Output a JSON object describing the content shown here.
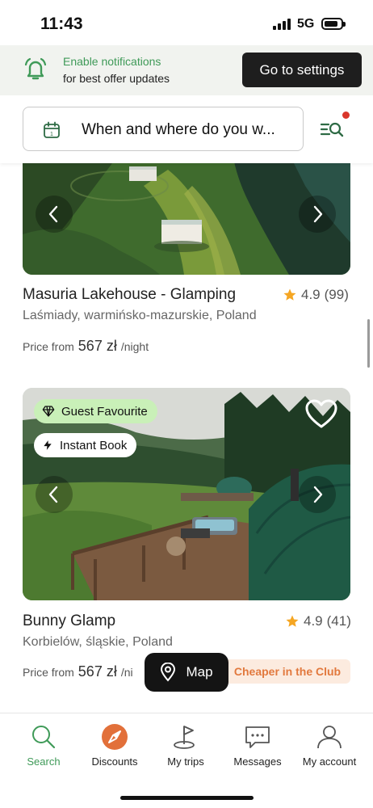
{
  "status_bar": {
    "time": "11:43",
    "network": "5G"
  },
  "notification_banner": {
    "title": "Enable notifications",
    "subtitle": "for best offer updates",
    "button": "Go to settings",
    "icon": "bell-ringing-icon",
    "accent": "#3f9a58"
  },
  "search": {
    "placeholder": "When and where do you w...",
    "icon": "calendar-icon",
    "filter_icon": "search-filter-icon",
    "filter_dot_color": "#d9362b"
  },
  "listings": [
    {
      "title": "Masuria Lakehouse - Glamping",
      "rating": "4.9",
      "reviews": "(99)",
      "location": "Laśmiady, warmińsko-mazurskie, Poland",
      "price_prefix": "Price from",
      "price": "567 zł",
      "price_suffix": "/night"
    },
    {
      "badges": [
        "Guest Favourite",
        "Instant Book"
      ],
      "title": "Bunny Glamp",
      "rating": "4.9",
      "reviews": "(41)",
      "location": "Korbielów, śląskie, Poland",
      "price_prefix": "Price from",
      "price": "567 zł",
      "price_suffix": "/ni",
      "club_badge": "Cheaper in the Club"
    }
  ],
  "map_button": {
    "label": "Map"
  },
  "bottom_nav": {
    "items": [
      {
        "label": "Search",
        "icon": "search-icon",
        "active": true
      },
      {
        "label": "Discounts",
        "icon": "compass-icon",
        "active": false
      },
      {
        "label": "My trips",
        "icon": "pin-trips-icon",
        "active": false
      },
      {
        "label": "Messages",
        "icon": "chat-icon",
        "active": false
      },
      {
        "label": "My account",
        "icon": "user-icon",
        "active": false
      }
    ]
  },
  "colors": {
    "accent_green": "#3f9a58",
    "club_orange": "#e2793e",
    "star": "#f5a623",
    "discount_orange": "#e2703a"
  }
}
